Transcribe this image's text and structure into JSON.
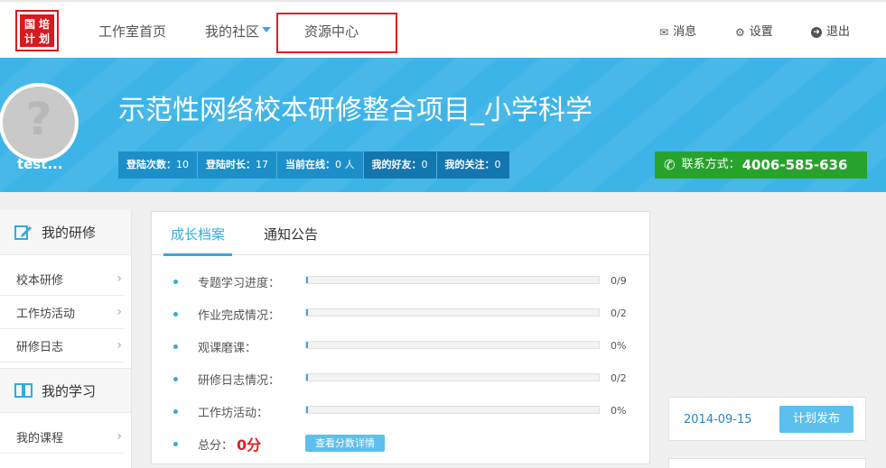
{
  "logo": {
    "chars": [
      "国",
      "培",
      "计",
      "划"
    ]
  },
  "nav": {
    "home": "工作室首页",
    "community": "我的社区",
    "resources": "资源中心"
  },
  "tools": {
    "messages": "消息",
    "settings": "设置",
    "logout": "退出"
  },
  "profile": {
    "username": "test...",
    "project_title": "示范性网络校本研修整合项目_小学科学"
  },
  "stats": [
    {
      "label": "登陆次数：",
      "value": "10"
    },
    {
      "label": "登陆时长：",
      "value": "17"
    },
    {
      "label": "当前在线：",
      "value": "0 人"
    },
    {
      "label": "我的好友：",
      "value": "0"
    },
    {
      "label": "我的关注：",
      "value": "0"
    }
  ],
  "contact": {
    "label": "联系方式：",
    "phone": "4006-585-636"
  },
  "sidebar": {
    "section1_title": "我的研修",
    "section1_items": [
      "校本研修",
      "工作坊活动",
      "研修日志"
    ],
    "section2_title": "我的学习",
    "section2_items": [
      "我的课程"
    ]
  },
  "panel": {
    "tabs": [
      "成长档案",
      "通知公告"
    ],
    "rows": [
      {
        "label": "专题学习进度：",
        "value": "0/9",
        "progress": 0.0
      },
      {
        "label": "作业完成情况：",
        "value": "0/2",
        "progress": 0.0
      },
      {
        "label": "观课磨课：",
        "value": "0%",
        "progress": 0.0
      },
      {
        "label": "研修日志情况：",
        "value": "0/2",
        "progress": 0.0
      },
      {
        "label": "工作坊活动：",
        "value": "0%",
        "progress": 0.0
      }
    ],
    "score_label": "总分：",
    "score_value": "0分",
    "detail_button": "查看分数详情"
  },
  "right": {
    "date": "2014-09-15",
    "plan_button": "计划发布"
  },
  "colors": {
    "accent": "#36a9e1",
    "banner": "#3db4e8",
    "contact": "#27a32c",
    "highlight": "#e02020"
  }
}
